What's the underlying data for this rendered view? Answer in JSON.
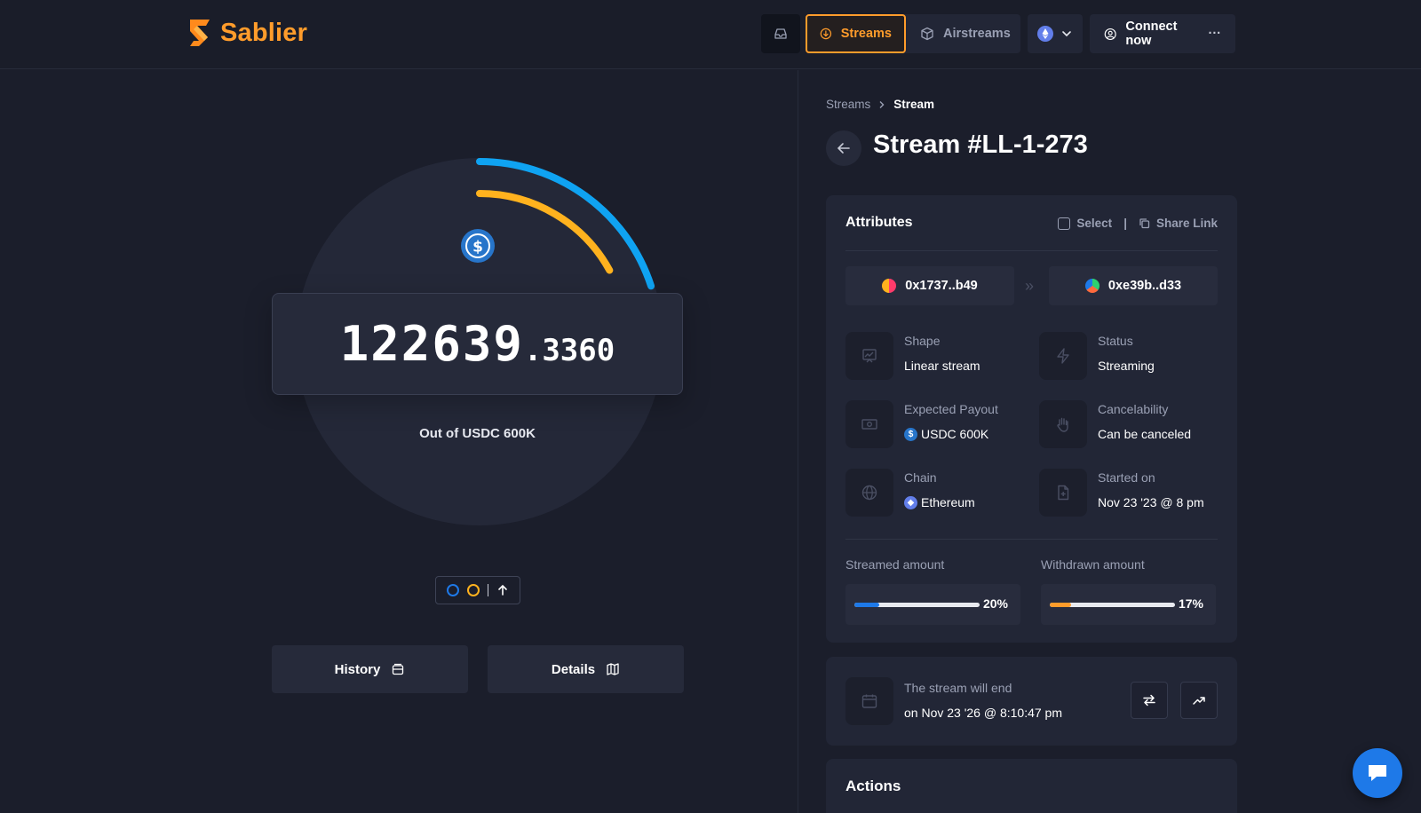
{
  "brand": {
    "name": "Sablier",
    "accent": "#ff9c2b"
  },
  "nav": {
    "inbox_icon": "inbox-icon",
    "streams_label": "Streams",
    "airstreams_label": "Airstreams",
    "chain_icon": "ethereum-icon",
    "connect_label": "Connect now",
    "more_label": "···"
  },
  "stream": {
    "amount_integer": "122639",
    "amount_decimal": ".3360",
    "out_of": "Out of USDC 600K",
    "streamed_fraction": 0.2,
    "withdrawn_fraction": 0.17,
    "colors": {
      "streamed": "#0fa3f2",
      "withdrawn": "#ffb21e"
    }
  },
  "buttons": {
    "history": "History",
    "details": "Details"
  },
  "breadcrumb": {
    "root": "Streams",
    "current": "Stream"
  },
  "title": "Stream #LL-1-273",
  "attributes": {
    "title": "Attributes",
    "select_label": "Select",
    "separator": "|",
    "share_label": "Share Link",
    "sender": "0x1737..b49",
    "recipient": "0xe39b..d33",
    "shape": {
      "label": "Shape",
      "value": "Linear stream"
    },
    "status": {
      "label": "Status",
      "value": "Streaming"
    },
    "payout": {
      "label": "Expected Payout",
      "value": "USDC 600K"
    },
    "cancel": {
      "label": "Cancelability",
      "value": "Can be canceled"
    },
    "chain": {
      "label": "Chain",
      "value": "Ethereum"
    },
    "started": {
      "label": "Started on",
      "value": "Nov 23 '23 @ 8 pm"
    },
    "streamed": {
      "label": "Streamed amount",
      "pct": "20%",
      "value": 0.2
    },
    "withdrawn": {
      "label": "Withdrawn amount",
      "pct": "17%",
      "value": 0.17
    }
  },
  "end": {
    "line1": "The stream will end",
    "line2": "on Nov 23 '26 @ 8:10:47 pm"
  },
  "actions": {
    "title": "Actions"
  }
}
